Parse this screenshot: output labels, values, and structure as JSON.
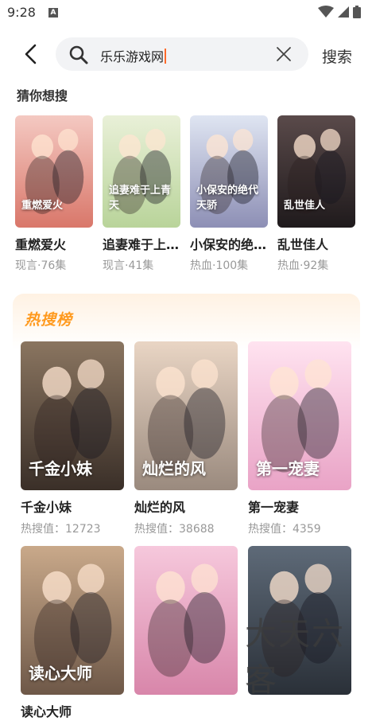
{
  "status": {
    "time": "9:28",
    "sim_label": "A"
  },
  "search": {
    "query": "乐乐游戏网",
    "button_label": "搜索"
  },
  "guess": {
    "title": "猜你想搜",
    "items": [
      {
        "name": "重燃爱火",
        "meta": "现言·76集",
        "caption": "重燃爱火",
        "colors": [
          "#f4c9c2",
          "#d9776a"
        ]
      },
      {
        "name": "追妻难于上青天",
        "meta": "现言·41集",
        "caption": "追妻难于上青天",
        "colors": [
          "#e9f0d8",
          "#b9d49a"
        ]
      },
      {
        "name": "小保安的绝代天骄",
        "meta": "热血·100集",
        "caption": "小保安的绝代天骄",
        "colors": [
          "#dfe5f2",
          "#8d8fb5"
        ]
      },
      {
        "name": "乱世佳人",
        "meta": "热血·92集",
        "caption": "乱世佳人",
        "colors": [
          "#5a4a4a",
          "#1f1a1c"
        ]
      }
    ]
  },
  "hot": {
    "title": "热搜榜",
    "items": [
      {
        "name": "千金小妹",
        "meta": "热搜值：12723",
        "caption": "千金小妹",
        "colors": [
          "#8a7560",
          "#3a2f28"
        ]
      },
      {
        "name": "灿烂的风",
        "meta": "热搜值：38688",
        "caption": "灿烂的风",
        "colors": [
          "#e9d5c4",
          "#9a8a7e"
        ]
      },
      {
        "name": "第一宠妻",
        "meta": "热搜值：4359",
        "caption": "第一宠妻",
        "colors": [
          "#ffe3f0",
          "#e9a3c6"
        ]
      },
      {
        "name": "读心大师",
        "meta": "",
        "caption": "读心大师",
        "colors": [
          "#c9a98a",
          "#6e5848"
        ]
      },
      {
        "name": "",
        "meta": "",
        "caption": "",
        "colors": [
          "#f6c8dc",
          "#d886aa"
        ]
      },
      {
        "name": "",
        "meta": "",
        "caption": "",
        "colors": [
          "#5e6a78",
          "#2a3038"
        ]
      }
    ]
  },
  "watermark": "大天六客"
}
